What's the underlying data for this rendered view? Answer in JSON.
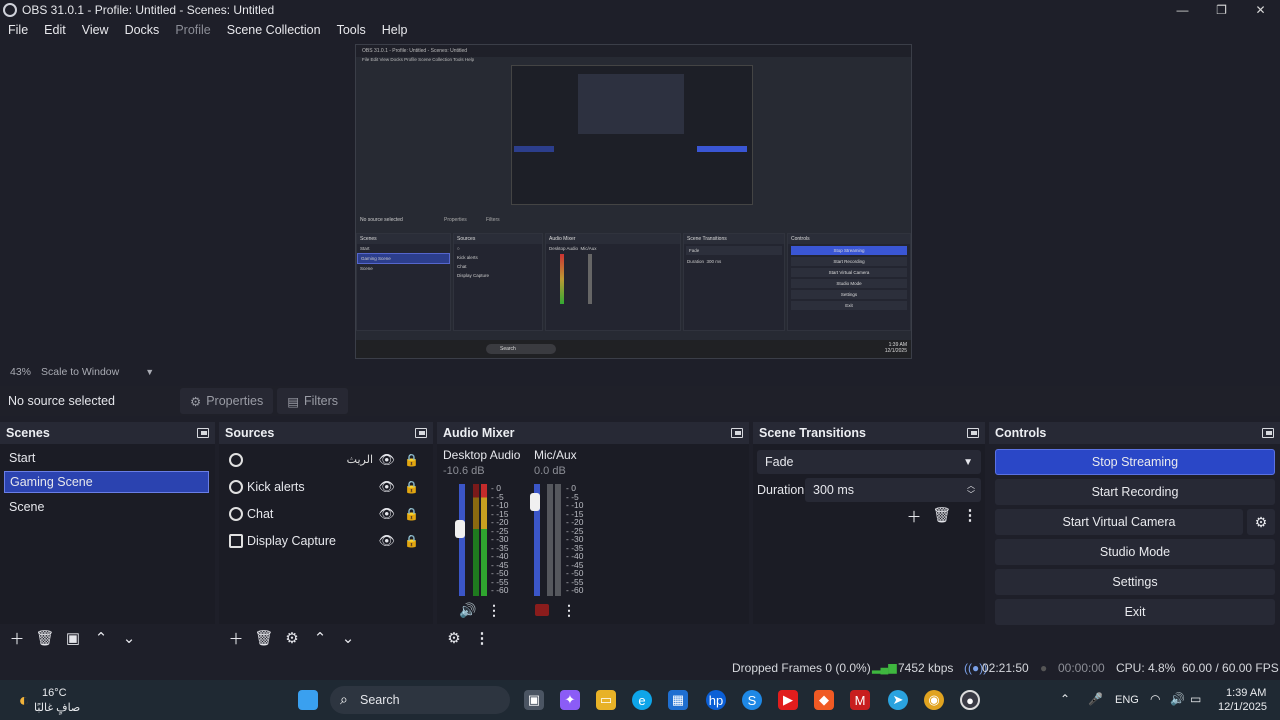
{
  "window": {
    "title": "OBS 31.0.1 - Profile: Untitled - Scenes: Untitled",
    "controls": [
      "—",
      "❐",
      "✕"
    ]
  },
  "menu": {
    "file": "File",
    "edit": "Edit",
    "view": "View",
    "docks": "Docks",
    "profile": "Profile",
    "scene_collection": "Scene Collection",
    "tools": "Tools",
    "help": "Help"
  },
  "preview": {
    "zoom": "43%",
    "scale_mode": "Scale to Window",
    "nested_title": "OBS 31.0.1 - Profile: Untitled - Scenes: Untitled",
    "nested_menu": "File  Edit  View  Docks  Profile  Scene Collection  Tools  Help",
    "nested_no_source": "No source selected",
    "nested_properties": "Properties",
    "nested_filters": "Filters",
    "nested_scenes_title": "Scenes",
    "nested_scenes": [
      "Start",
      "Gaming Scene",
      "Scene"
    ],
    "nested_sources_title": "Sources",
    "nested_sources": [
      "Kick alerts",
      "Chat",
      "Display Capture"
    ],
    "nested_mixer_title": "Audio Mixer",
    "nested_desktop_audio": "Desktop Audio",
    "nested_mic": "Mic/Aux",
    "nested_transitions_title": "Scene Transitions",
    "nested_fade": "Fade",
    "nested_duration": "Duration",
    "nested_duration_value": "300 ms",
    "nested_controls_title": "Controls",
    "nested_controls": [
      "Stop Streaming",
      "Start Recording",
      "Start Virtual Camera",
      "Studio Mode",
      "Settings",
      "Exit"
    ],
    "nested_search": "Search",
    "nested_time": "1:39 AM",
    "nested_date": "12/1/2025"
  },
  "source_bar": {
    "no_source": "No source selected",
    "properties": "Properties",
    "filters": "Filters"
  },
  "scenes": {
    "title": "Scenes",
    "items": [
      "Start",
      "Gaming Scene",
      "Scene"
    ],
    "selected_index": 1
  },
  "sources": {
    "title": "Sources",
    "items": [
      {
        "label": "",
        "extra": "الريث",
        "icon": "browser-source-icon"
      },
      {
        "label": "Kick alerts",
        "extra": "",
        "icon": "browser-source-icon"
      },
      {
        "label": "Chat",
        "extra": "",
        "icon": "browser-source-icon"
      },
      {
        "label": "Display Capture",
        "extra": "",
        "icon": "monitor-icon"
      }
    ]
  },
  "mixer": {
    "title": "Audio Mixer",
    "channels": [
      {
        "name": "Desktop Audio",
        "db": "-10.6 dB",
        "level": 0.62
      },
      {
        "name": "Mic/Aux",
        "db": "0.0 dB",
        "level": 0.9
      }
    ],
    "scale": [
      "0",
      "-5",
      "-10",
      "-15",
      "-20",
      "-25",
      "-30",
      "-35",
      "-40",
      "-45",
      "-50",
      "-55",
      "-60"
    ]
  },
  "transitions": {
    "title": "Scene Transitions",
    "type": "Fade",
    "duration_label": "Duration",
    "duration_value": "300 ms"
  },
  "controls": {
    "title": "Controls",
    "stop_streaming": "Stop Streaming",
    "start_recording": "Start Recording",
    "start_virtual_camera": "Start Virtual Camera",
    "studio_mode": "Studio Mode",
    "settings": "Settings",
    "exit": "Exit"
  },
  "stats": {
    "dropped_frames": "Dropped Frames 0 (0.0%)",
    "bitrate": "7452 kbps",
    "stream_time": "02:21:50",
    "rec_time": "00:00:00",
    "cpu": "CPU: 4.8%",
    "fps": "60.00 / 60.00 FPS"
  },
  "taskbar": {
    "weather_temp": "16°C",
    "weather_desc": "صافٍ غالبًا",
    "search": "Search",
    "lang": "ENG",
    "time": "1:39 AM",
    "date": "12/1/2025"
  },
  "colors": {
    "accent": "#2a47c7",
    "bg": "#1e1f29",
    "panel": "#272935"
  }
}
